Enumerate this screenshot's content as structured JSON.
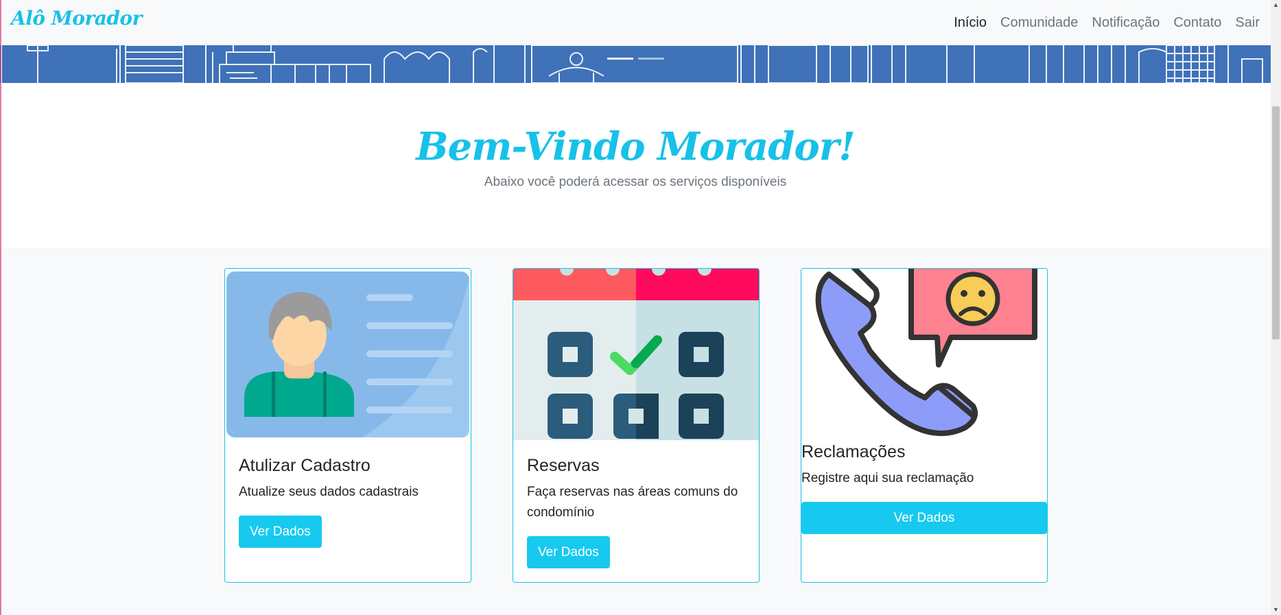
{
  "brand": {
    "name": "Alô Morador"
  },
  "nav": {
    "items": [
      "Início",
      "Comunidade",
      "Notificação",
      "Contato",
      "Sair"
    ],
    "active": "Início"
  },
  "hero": {
    "title": "Bem-Vindo Morador!",
    "subtitle": "Abaixo você poderá acessar os serviços disponíveis"
  },
  "cards": [
    {
      "title": "Atulizar Cadastro",
      "text": "Atualize seus dados cadastrais",
      "button": "Ver Dados",
      "icon": "id-card-icon"
    },
    {
      "title": "Reservas",
      "text": "Faça reservas nas áreas comuns do condomínio",
      "button": "Ver Dados",
      "icon": "calendar-check-icon"
    },
    {
      "title": "Reclamações",
      "text": "Registre aqui sua reclamação",
      "button": "Ver Dados",
      "icon": "phone-complaint-icon"
    }
  ],
  "colors": {
    "accent": "#17c1e8",
    "button": "#17c9ee",
    "banner": "#3f72b8",
    "navbar": "#f8f9fa"
  }
}
